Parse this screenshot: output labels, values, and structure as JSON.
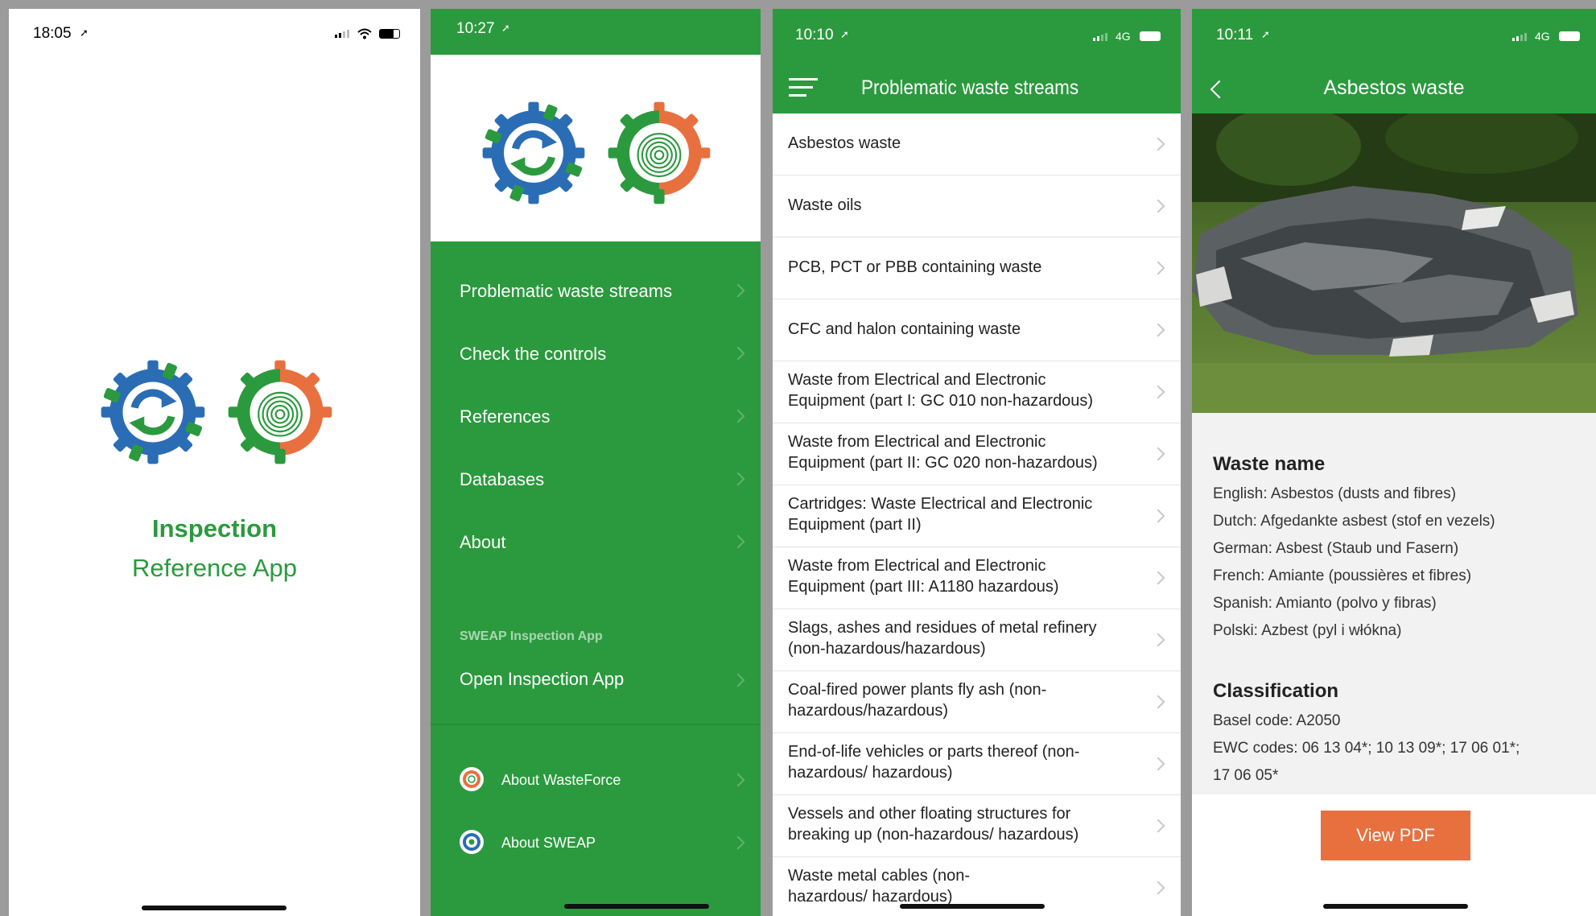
{
  "colors": {
    "green": "#2b9a3e",
    "orange": "#e8703f",
    "blue": "#2a6db5",
    "frame": "#9b9b9b"
  },
  "screen1": {
    "time": "18:05",
    "logo_title": "Inspection",
    "logo_subtitle": "Reference App"
  },
  "screen2": {
    "time": "10:27",
    "menu": [
      {
        "label": "Problematic waste streams"
      },
      {
        "label": "Check the controls"
      },
      {
        "label": "References"
      },
      {
        "label": "Databases"
      },
      {
        "label": "About"
      }
    ],
    "section_header": "SWEAP Inspection App",
    "open_app_label": "Open Inspection App",
    "footer_items": [
      {
        "label": "About WasteForce",
        "icon": "fingerprint-gear-icon"
      },
      {
        "label": "About SWEAP",
        "icon": "sweap-gear-icon"
      }
    ]
  },
  "screen3": {
    "time": "10:10",
    "network": "4G",
    "title": "Problematic waste streams",
    "items": [
      {
        "line1": "Asbestos waste",
        "line2": ""
      },
      {
        "line1": "Waste oils",
        "line2": ""
      },
      {
        "line1": "PCB, PCT or PBB containing waste",
        "line2": ""
      },
      {
        "line1": "CFC and halon containing waste",
        "line2": ""
      },
      {
        "line1": "Waste from Electrical and Electronic",
        "line2": "Equipment (part I: GC 010 non-hazardous)"
      },
      {
        "line1": "Waste from Electrical and Electronic",
        "line2": "Equipment (part II: GC 020 non-hazardous)"
      },
      {
        "line1": "Cartridges: Waste Electrical and Electronic",
        "line2": "Equipment (part II)"
      },
      {
        "line1": "Waste from Electrical and Electronic",
        "line2": "Equipment (part III: A1180 hazardous)"
      },
      {
        "line1": "Slags, ashes and residues of metal refinery",
        "line2": "(non-hazardous/hazardous)"
      },
      {
        "line1": "Coal-fired power plants fly ash (non-",
        "line2": "hazardous/hazardous)"
      },
      {
        "line1": "End-of-life vehicles or parts thereof (non-",
        "line2": "hazardous/ hazardous)"
      },
      {
        "line1": "Vessels and other floating structures for",
        "line2": "breaking up (non-hazardous/ hazardous)"
      },
      {
        "line1": "Waste metal cables (non-",
        "line2": "hazardous/ hazardous)"
      }
    ]
  },
  "screen4": {
    "time": "10:11",
    "network": "4G",
    "title": "Asbestos waste",
    "waste_name_heading": "Waste name",
    "names": [
      "English: Asbestos (dusts and fibres)",
      "Dutch: Afgedankte asbest (stof en vezels)",
      "German: Asbest (Staub und Fasern)",
      "French: Amiante (poussières et fibres)",
      "Spanish: Amianto (polvo y fibras)",
      "Polski: Azbest (pyl i włókna)"
    ],
    "classification_heading": "Classification",
    "basel_code": "Basel code: A2050",
    "ewc_codes": "EWC codes: 06 13 04*; 10 13 09*; 17 06 01*;",
    "ewc_codes_cont": "17 06 05*",
    "view_pdf": "View PDF"
  }
}
